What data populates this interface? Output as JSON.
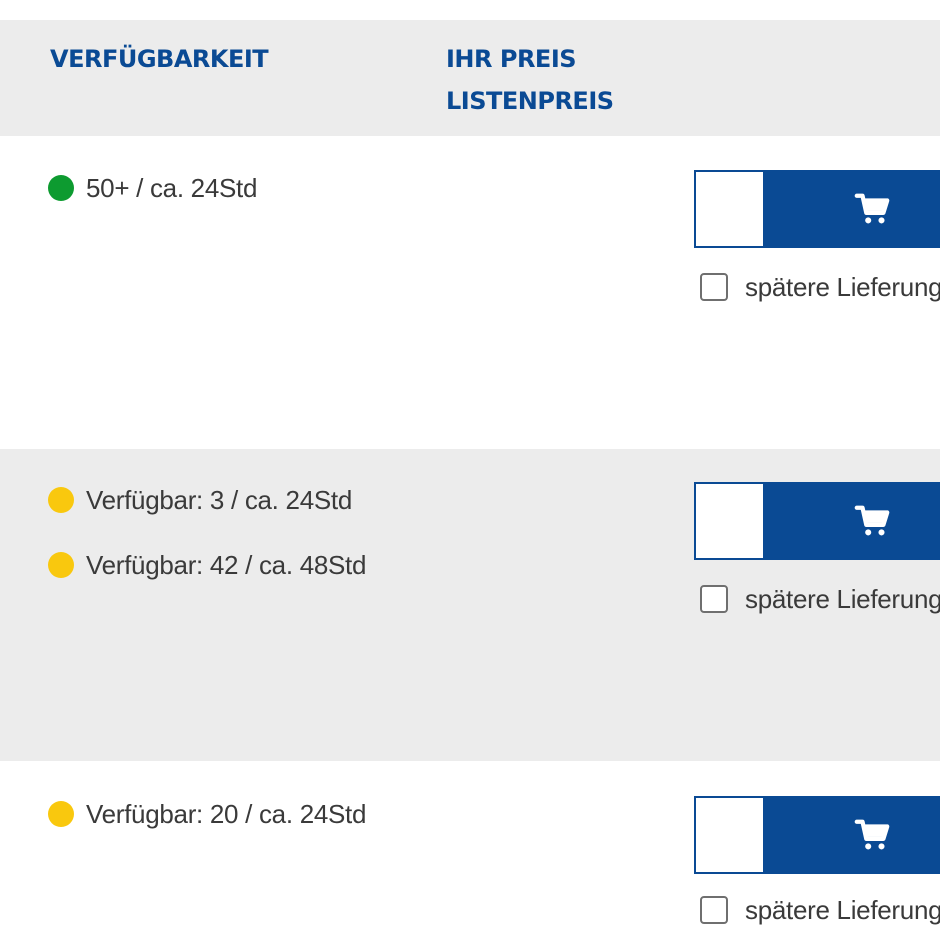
{
  "header": {
    "availability_label": "VERFÜGBARKEIT",
    "your_price_label": "IHR PREIS",
    "list_price_label": "LISTENPREIS"
  },
  "colors": {
    "brand_blue": "#0a4a94",
    "stock_green": "#0d9b30",
    "stock_yellow": "#f9c80e",
    "row_shade": "#ececec"
  },
  "rows": [
    {
      "availability": [
        {
          "status": "green",
          "text": "50+ / ca. 24Std"
        }
      ],
      "quantity": "",
      "cart_icon": "shopping-cart-icon",
      "later_delivery_label": "spätere Lieferung",
      "later_delivery_checked": false
    },
    {
      "availability": [
        {
          "status": "yellow",
          "text": "Verfügbar: 3 / ca. 24Std"
        },
        {
          "status": "yellow",
          "text": "Verfügbar: 42 / ca. 48Std"
        }
      ],
      "quantity": "",
      "cart_icon": "shopping-cart-icon",
      "later_delivery_label": "spätere Lieferung",
      "later_delivery_checked": false
    },
    {
      "availability": [
        {
          "status": "yellow",
          "text": "Verfügbar: 20 / ca. 24Std"
        }
      ],
      "quantity": "",
      "cart_icon": "shopping-cart-icon",
      "later_delivery_label": "spätere Lieferung",
      "later_delivery_checked": false
    }
  ]
}
